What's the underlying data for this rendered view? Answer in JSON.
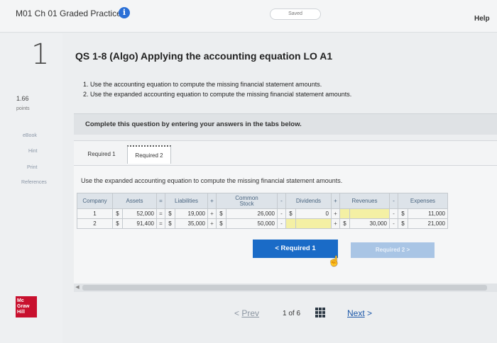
{
  "header": {
    "assignment_title": "M01 Ch 01 Graded Practice",
    "info_glyph": "i",
    "saved_label": "Saved",
    "help_label": "Help"
  },
  "question": {
    "number": "1",
    "points_value": "1.66",
    "points_label": "points",
    "title": "QS 1-8 (Algo) Applying the accounting equation LO A1",
    "instructions": [
      "1. Use the accounting equation to compute the missing financial statement amounts.",
      "2. Use the expanded accounting equation to compute the missing financial statement amounts."
    ]
  },
  "rail": {
    "links": [
      "eBook",
      "Hint",
      "Print",
      "References"
    ],
    "logo_lines": [
      "Mc",
      "Graw",
      "Hill"
    ]
  },
  "complete_text": "Complete this question by entering your answers in the tabs below.",
  "tabs": [
    {
      "label": "Required 1",
      "active": false
    },
    {
      "label": "Required 2",
      "active": true
    }
  ],
  "panel": {
    "instruction": "Use the expanded accounting equation to compute the missing financial statement amounts.",
    "headers": {
      "company": "Company",
      "assets": "Assets",
      "eq": "=",
      "liabilities": "Liabilities",
      "plus1": "+",
      "common_stock_1": "Common",
      "common_stock_2": "Stock",
      "minus1": "-",
      "dividends": "Dividends",
      "plus2": "+",
      "revenues": "Revenues",
      "minus2": "-",
      "expenses": "Expenses"
    },
    "rows": [
      {
        "company": "1",
        "assets_cur": "$",
        "assets": "52,000",
        "eq": "=",
        "liab_cur": "$",
        "liabilities": "19,000",
        "plus1": "+",
        "cs_cur": "$",
        "common_stock": "26,000",
        "minus1": "-",
        "div_cur": "$",
        "dividends": "0",
        "plus2": "+",
        "rev_cur": "",
        "revenues": "",
        "minus2": "-",
        "exp_cur": "$",
        "expenses": "11,000"
      },
      {
        "company": "2",
        "assets_cur": "$",
        "assets": "91,400",
        "eq": "=",
        "liab_cur": "$",
        "liabilities": "35,000",
        "plus1": "+",
        "cs_cur": "$",
        "common_stock": "50,000",
        "minus1": "-",
        "div_cur": "",
        "dividends": "",
        "plus2": "+",
        "rev_cur": "$",
        "revenues": "30,000",
        "minus2": "-",
        "exp_cur": "$",
        "expenses": "21,000"
      }
    ],
    "prev_tab_button": "< Required 1",
    "next_tab_button": "Required 2 >"
  },
  "pager": {
    "prev_glyph": "<",
    "prev_label": "Prev",
    "current": "1",
    "of_label": "of",
    "total": "6",
    "next_label": "Next",
    "next_glyph": ">"
  },
  "colors": {
    "accent": "#1a6bc7",
    "input_highlight": "#f4f0a4",
    "brand": "#c8102e"
  }
}
